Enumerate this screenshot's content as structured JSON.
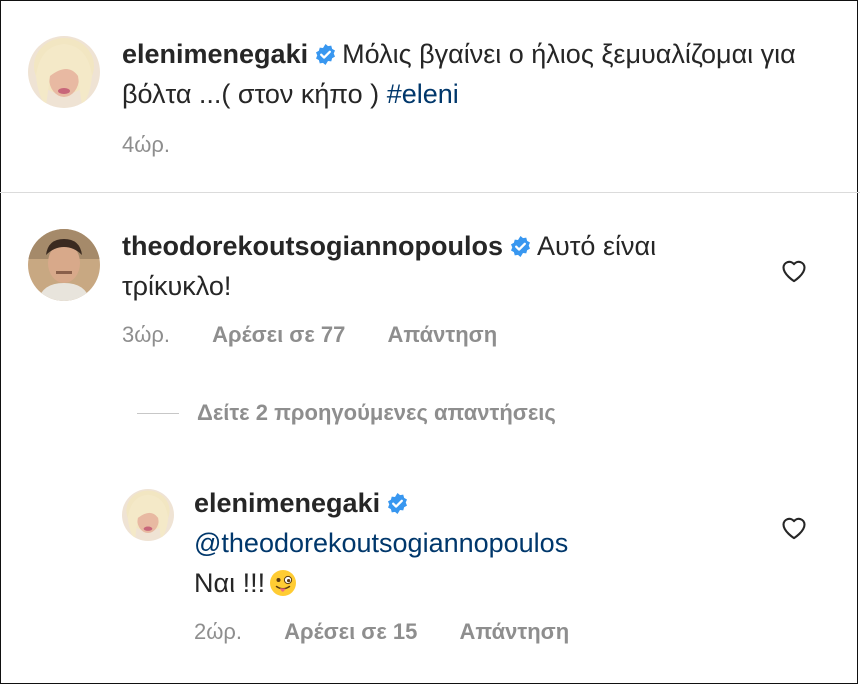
{
  "caption": {
    "username": "elenimenegaki",
    "text": "Μόλις βγαίνει ο ήλιος ξεμυαλίζομαι για βόλτα ...( στον κήπο )",
    "hashtag": "#eleni",
    "time": "4ώρ."
  },
  "comment": {
    "username": "theodorekoutsogiannopoulos",
    "text": "Αυτό είναι τρίκυκλο!",
    "time": "3ώρ.",
    "likes": "Αρέσει σε 77",
    "reply_label": "Απάντηση"
  },
  "view_replies": "Δείτε 2 προηγούμενες απαντήσεις",
  "reply": {
    "username": "elenimenegaki",
    "mention": "@theodorekoutsogiannopoulos",
    "text": "Ναι !!!",
    "time": "2ώρ.",
    "likes": "Αρέσει σε 15",
    "reply_label": "Απάντηση"
  },
  "colors": {
    "text": "#262626",
    "meta": "#8e8e8e",
    "link": "#00376b",
    "verified": "#3897f0"
  },
  "icons": [
    "verified-badge-icon",
    "heart-outline-icon",
    "winking-tongue-emoji"
  ]
}
